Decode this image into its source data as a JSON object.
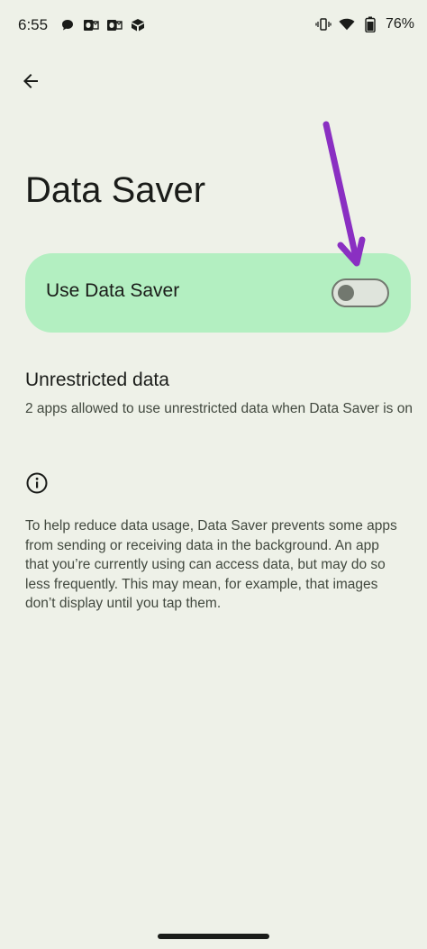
{
  "status_bar": {
    "time": "6:55",
    "notification_icons": [
      "chat-bubble-icon",
      "outlook-icon",
      "outlook-icon",
      "box-icon"
    ],
    "system_icons": [
      "vibrate-icon",
      "wifi-icon",
      "battery-icon"
    ],
    "battery_percent": "76%"
  },
  "header": {
    "back_icon": "arrow-back-icon",
    "title": "Data Saver"
  },
  "toggle": {
    "label": "Use Data Saver",
    "checked": false,
    "card_color": "#b3efc1"
  },
  "unrestricted": {
    "title": "Unrestricted data",
    "summary": "2 apps allowed to use unrestricted data when Data Saver is on"
  },
  "footer": {
    "icon": "info-icon",
    "text": "To help reduce data usage, Data Saver prevents some apps from sending or receiving data in the background. An app that you’re currently using can access data, but may do so less frequently. This may mean, for example, that images don’t display until you tap them."
  },
  "annotation": {
    "arrow_color": "#8a2fc2"
  },
  "colors": {
    "background": "#eef1e8",
    "text_primary": "#1a1c19",
    "text_secondary": "#42493f",
    "switch_outline": "#72786f"
  }
}
